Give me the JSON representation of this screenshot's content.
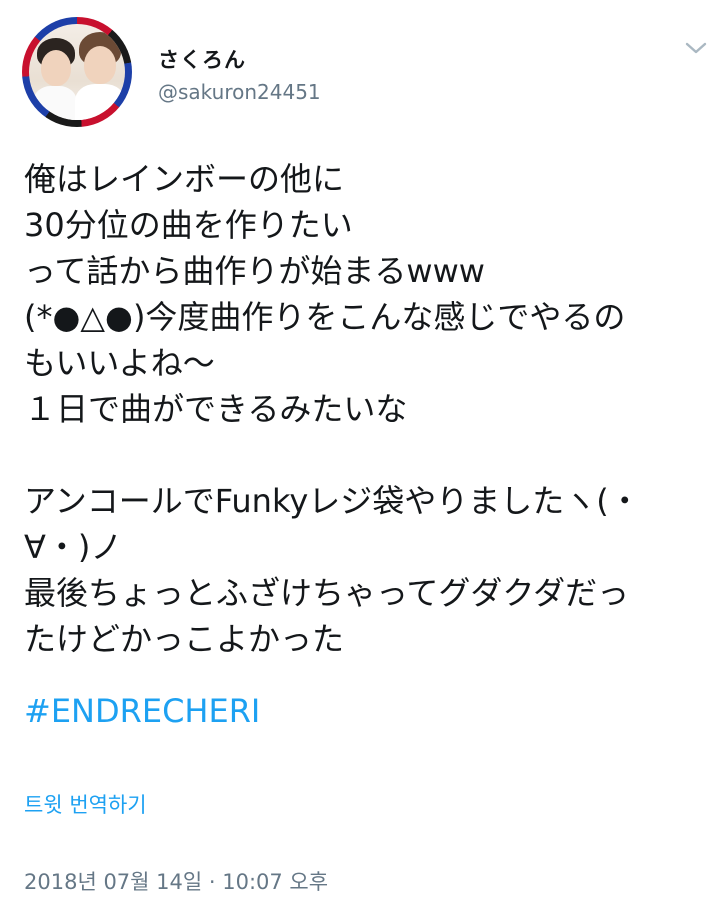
{
  "author": {
    "display_name": "さくろん",
    "handle": "@sakuron24451"
  },
  "tweet": {
    "lines": [
      "俺はレインボーの他に",
      "30分位の曲を作りたい",
      "って話から曲作りが始まるwww",
      "(*●△●)今度曲作りをこんな感じでやるの",
      "もいいよね〜",
      "１日で曲ができるみたいな",
      "",
      "アンコールでFunkyレジ袋やりましたヽ(・",
      "∀・)ノ",
      "最後ちょっとふざけちゃってグダクダだっ",
      "たけどかっこよかった"
    ],
    "hashtag": "#ENDRECHERI",
    "translate_label": "트윗 번역하기",
    "timestamp": "2018년 07월 14일 · 10:07 오후"
  },
  "icons": {
    "menu": "chevron-down-icon"
  },
  "colors": {
    "link": "#1da1f2",
    "secondary_text": "#657786",
    "primary_text": "#14171a"
  }
}
